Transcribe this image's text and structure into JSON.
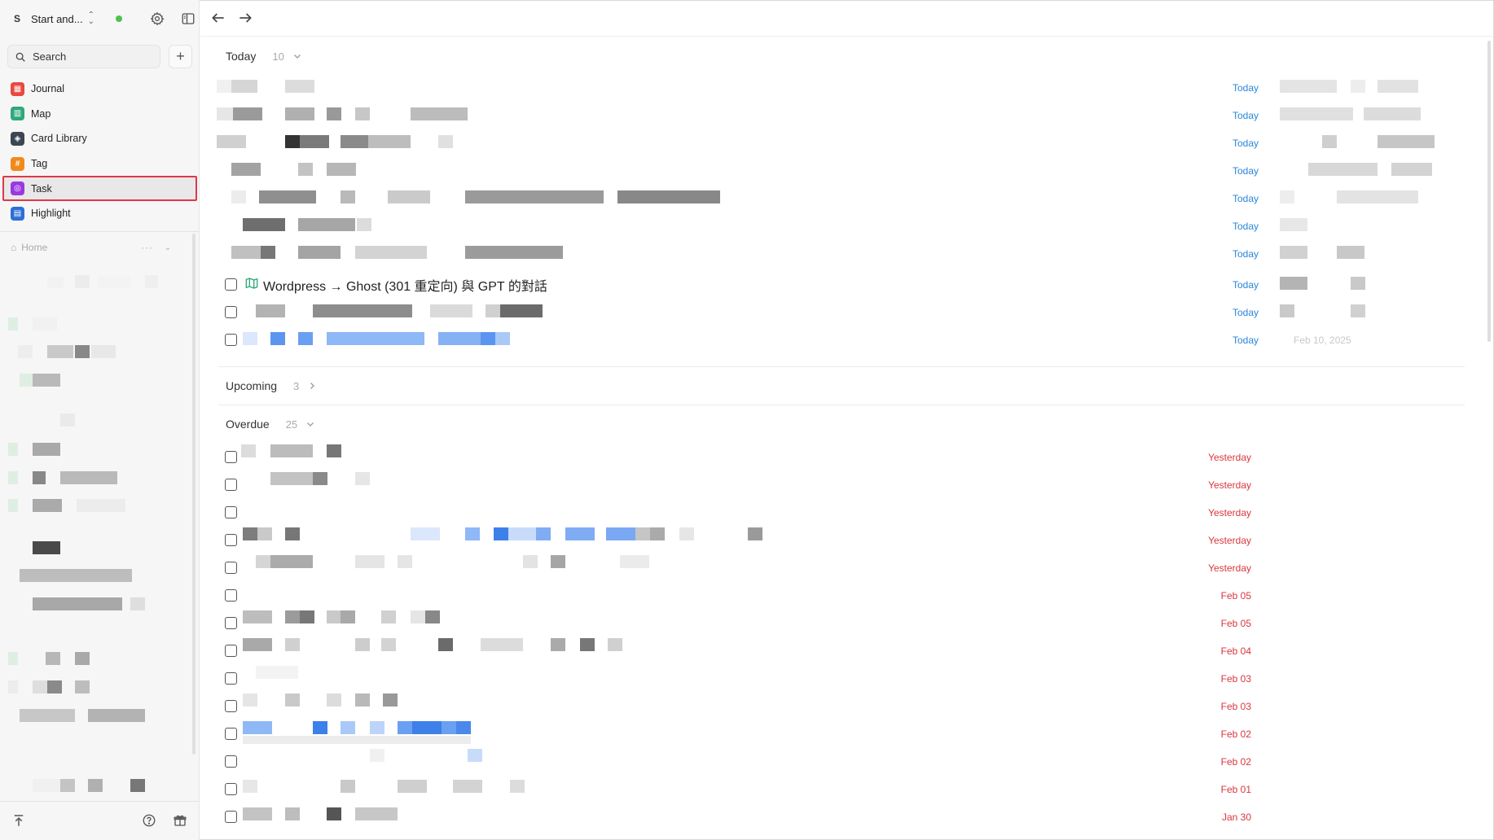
{
  "workspace": {
    "badge": "S",
    "name": "Start and..."
  },
  "sidebar": {
    "search_label": "Search",
    "add_label": "+",
    "items": [
      {
        "label": "Journal",
        "icon": "journal-icon",
        "color": "#e8493f",
        "glyph": "▦"
      },
      {
        "label": "Map",
        "icon": "map-icon",
        "color": "#2fa87a",
        "glyph": "▥"
      },
      {
        "label": "Card Library",
        "icon": "card-library-icon",
        "color": "#3b4553",
        "glyph": "◈"
      },
      {
        "label": "Tag",
        "icon": "tag-icon",
        "color": "#f08a1c",
        "glyph": "#"
      },
      {
        "label": "Task",
        "icon": "task-icon",
        "color": "#9b38e0",
        "glyph": "◎",
        "active": true
      },
      {
        "label": "Highlight",
        "icon": "highlight-icon",
        "color": "#2d6fd6",
        "glyph": "▤"
      }
    ],
    "home_label": "Home",
    "home_more": "···"
  },
  "sections": {
    "today": {
      "label": "Today",
      "count": "10"
    },
    "upcoming": {
      "label": "Upcoming",
      "count": "3"
    },
    "overdue": {
      "label": "Overdue",
      "count": "25"
    }
  },
  "today_tasks": [
    {
      "date": "Today"
    },
    {
      "date": "Today"
    },
    {
      "date": "Today"
    },
    {
      "date": "Today"
    },
    {
      "date": "Today"
    },
    {
      "date": "Today"
    },
    {
      "date": "Today"
    },
    {
      "date": "Today",
      "title": "Wordpress → Ghost (301 重定向) 與 GPT 的對話"
    },
    {
      "date": "Today"
    },
    {
      "date": "Today",
      "ghost_date": "Feb 10, 2025"
    }
  ],
  "overdue_tasks": [
    {
      "date": "Yesterday"
    },
    {
      "date": "Yesterday"
    },
    {
      "date": "Yesterday"
    },
    {
      "date": "Yesterday"
    },
    {
      "date": "Yesterday"
    },
    {
      "date": "Feb 05"
    },
    {
      "date": "Feb 05"
    },
    {
      "date": "Feb 04"
    },
    {
      "date": "Feb 03"
    },
    {
      "date": "Feb 03"
    },
    {
      "date": "Feb 02"
    },
    {
      "date": "Feb 02"
    },
    {
      "date": "Feb 01"
    },
    {
      "date": "Jan 30"
    }
  ],
  "colors": {
    "today_date": "#2a86d8",
    "overdue_date": "#d9363e",
    "active_outline": "#e0364c"
  }
}
